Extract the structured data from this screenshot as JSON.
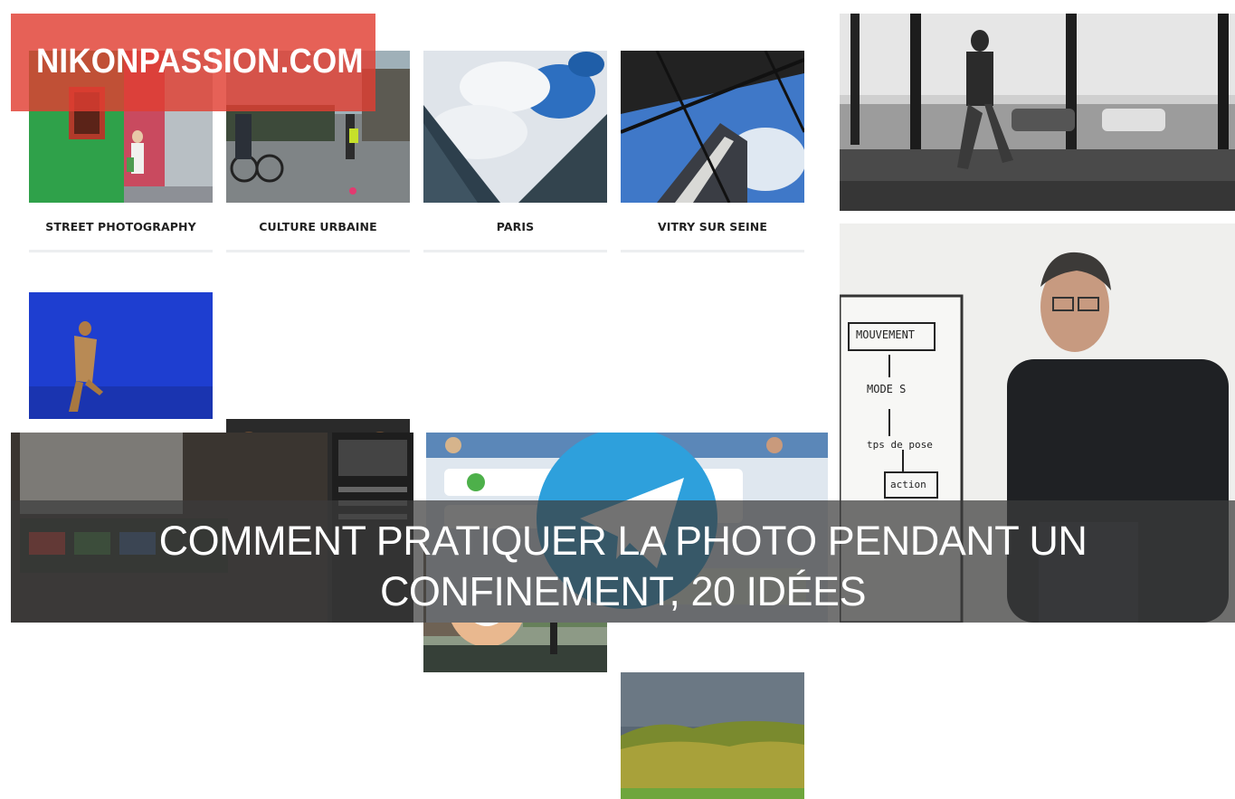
{
  "brand": {
    "name": "NIKONPASSION.COM"
  },
  "grid": {
    "top_row": [
      {
        "label": "STREET PHOTOGRAPHY"
      },
      {
        "label": "CULTURE URBAINE"
      },
      {
        "label": "PARIS"
      },
      {
        "label": "VITRY SUR SEINE"
      }
    ]
  },
  "headline": {
    "line1": "COMMENT PRATIQUER LA PHOTO PENDANT UN",
    "line2": "CONFINEMENT, 20 IDÉES"
  },
  "whiteboard": {
    "line1": "MOUVEMENT",
    "line2": "MODE S",
    "line3": "tps de pose",
    "line4": "action"
  },
  "colors": {
    "brand_red": "#e13e32",
    "overlay_gray": "#3c3c3c",
    "telegram_blue": "#2ea0dc"
  }
}
